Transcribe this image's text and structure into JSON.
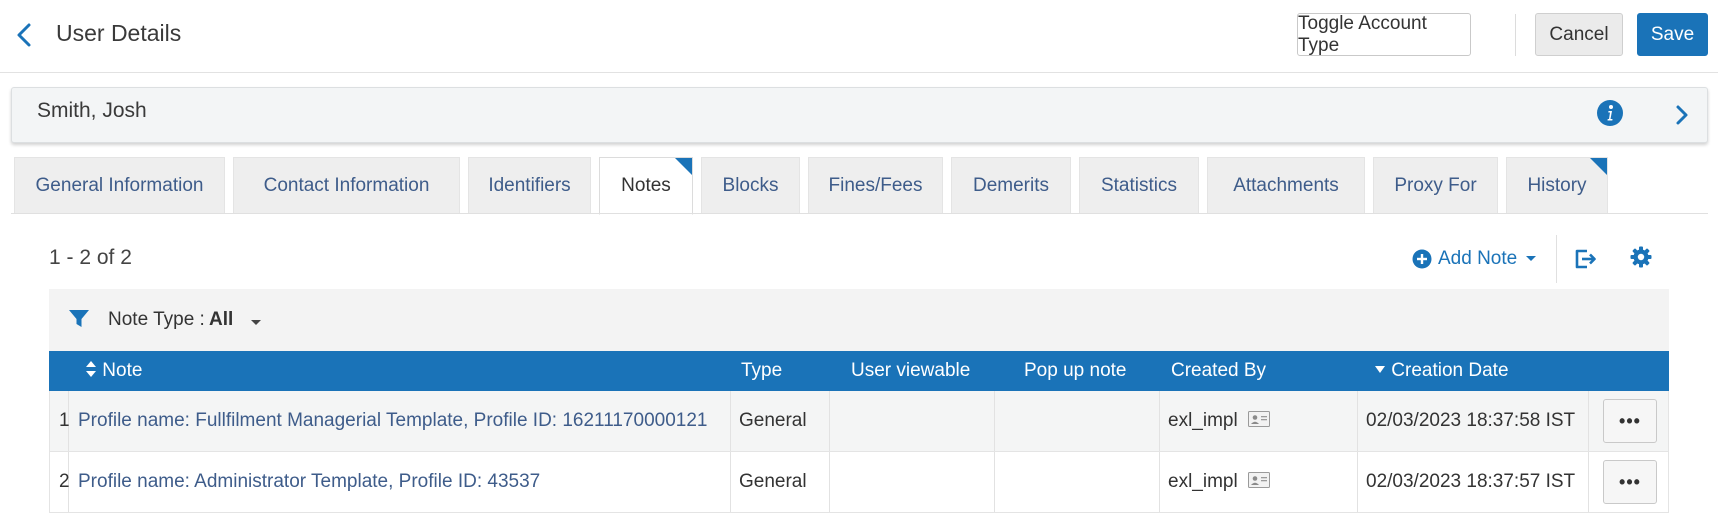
{
  "header": {
    "title": "User Details",
    "toggle_label": "Toggle Account Type",
    "cancel_label": "Cancel",
    "save_label": "Save"
  },
  "user": {
    "name": "Smith, Josh"
  },
  "tabs": [
    {
      "label": "General Information",
      "active": false,
      "flagged": false
    },
    {
      "label": "Contact Information",
      "active": false,
      "flagged": false
    },
    {
      "label": "Identifiers",
      "active": false,
      "flagged": false
    },
    {
      "label": "Notes",
      "active": true,
      "flagged": true
    },
    {
      "label": "Blocks",
      "active": false,
      "flagged": false
    },
    {
      "label": "Fines/Fees",
      "active": false,
      "flagged": false
    },
    {
      "label": "Demerits",
      "active": false,
      "flagged": false
    },
    {
      "label": "Statistics",
      "active": false,
      "flagged": false
    },
    {
      "label": "Attachments",
      "active": false,
      "flagged": false
    },
    {
      "label": "Proxy For",
      "active": false,
      "flagged": false
    },
    {
      "label": "History",
      "active": false,
      "flagged": true
    }
  ],
  "toolbar": {
    "count": "1 - 2 of 2",
    "add_note_label": "Add Note"
  },
  "filter": {
    "label": "Note Type :",
    "value": "All"
  },
  "table": {
    "columns": {
      "note": "Note",
      "type": "Type",
      "user_viewable": "User viewable",
      "popup": "Pop up note",
      "created_by": "Created By",
      "creation_date": "Creation Date"
    },
    "rows": [
      {
        "index": "1",
        "note": "Profile name: Fullfilment Managerial Template, Profile ID: 16211170000121",
        "type": "General",
        "user_viewable": "",
        "popup": "",
        "created_by": "exl_impl",
        "creation_date": "02/03/2023 18:37:58 IST",
        "actions": "•••"
      },
      {
        "index": "2",
        "note": "Profile name: Administrator Template, Profile ID: 43537",
        "type": "General",
        "user_viewable": "",
        "popup": "",
        "created_by": "exl_impl",
        "creation_date": "02/03/2023 18:37:57 IST",
        "actions": "•••"
      }
    ]
  },
  "colors": {
    "accent": "#1a73b8",
    "link": "#3e5c8a",
    "tab_bg": "#eeeeee"
  },
  "icons": {
    "back": "chevron-left-icon",
    "info": "info-icon",
    "expand": "chevron-right-icon",
    "add": "plus-circle-icon",
    "export": "export-icon",
    "settings": "gear-icon",
    "filter": "filter-icon",
    "sort": "sort-icon",
    "contact": "contact-card-icon"
  }
}
